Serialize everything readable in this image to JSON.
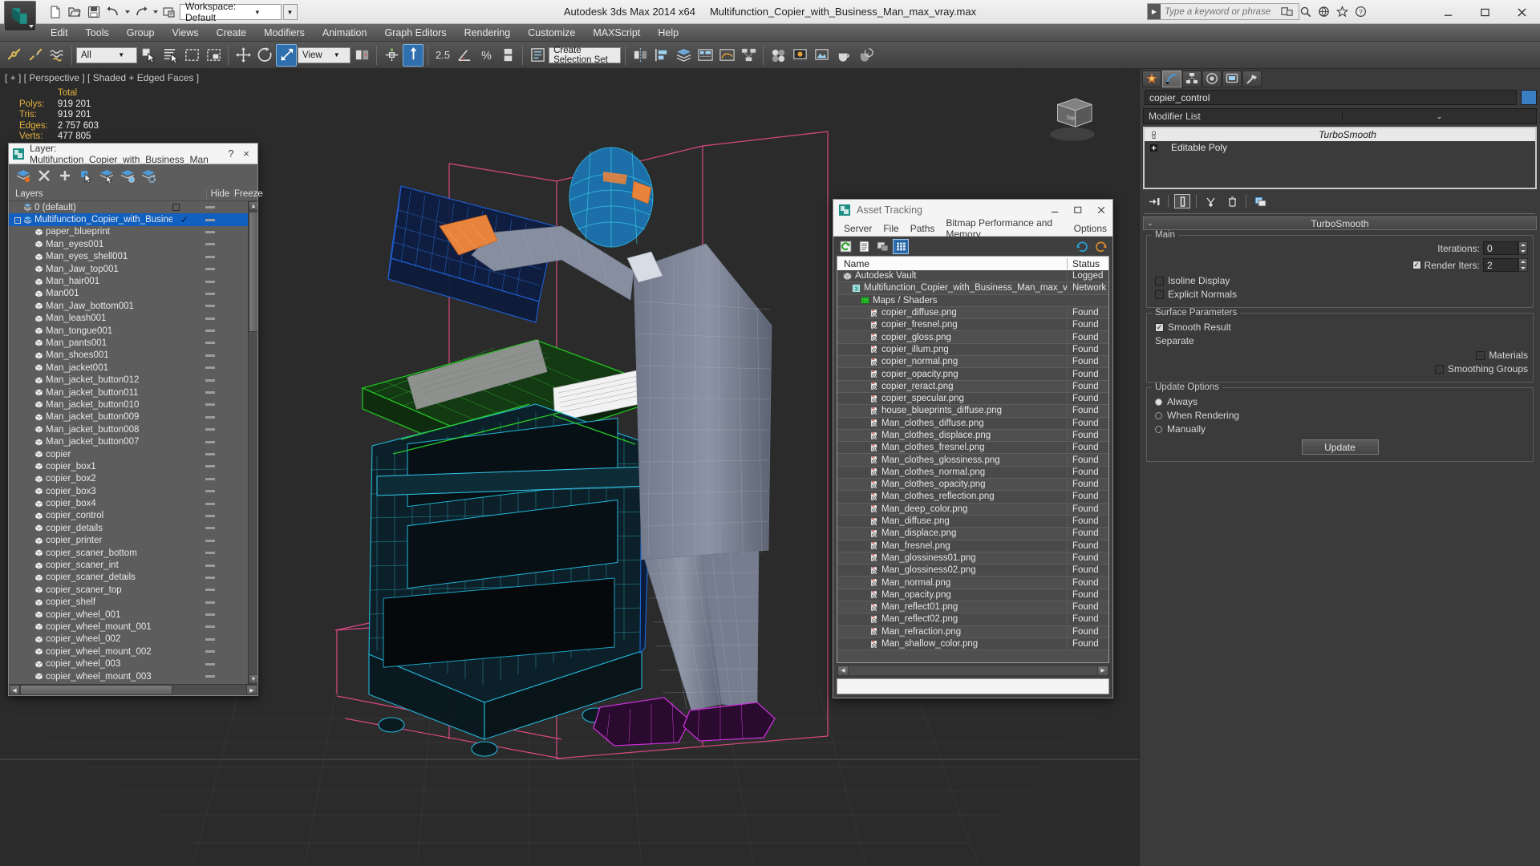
{
  "titlebar": {
    "app_title": "Autodesk 3ds Max  2014 x64",
    "file_title": "Multifunction_Copier_with_Business_Man_max_vray.max",
    "workspace_label": "Workspace: Default",
    "search_placeholder": "Type a keyword or phrase"
  },
  "menubar": {
    "items": [
      "Edit",
      "Tools",
      "Group",
      "Views",
      "Create",
      "Modifiers",
      "Animation",
      "Graph Editors",
      "Rendering",
      "Customize",
      "MAXScript",
      "Help"
    ]
  },
  "toolbar": {
    "selection_filter": "All",
    "reference_coord": "View",
    "angle_snap_value": "2.5",
    "named_selection_sets": "Create Selection Set"
  },
  "viewport": {
    "label": "[ + ] [ Perspective ] [ Shaded + Edged Faces ]",
    "stats": {
      "total_header": "Total",
      "rows": [
        {
          "label": "Polys:",
          "value": "919 201"
        },
        {
          "label": "Tris:",
          "value": "919 201"
        },
        {
          "label": "Edges:",
          "value": "2 757 603"
        },
        {
          "label": "Verts:",
          "value": "477 805"
        }
      ]
    }
  },
  "layer_dialog": {
    "title": "Layer: Multifunction_Copier_with_Business_Man",
    "help_label": "?",
    "close_label": "×",
    "columns": {
      "layers": "Layers",
      "hide": "Hide",
      "freeze": "Freeze"
    },
    "rows": [
      {
        "name": "0 (default)",
        "indent": 0,
        "type": "layer",
        "selected": false,
        "expander": "",
        "check": "box"
      },
      {
        "name": "Multifunction_Copier_with_Business_Man",
        "indent": 0,
        "type": "layer",
        "selected": true,
        "expander": "-",
        "check": "tick"
      },
      {
        "name": "paper_blueprint",
        "indent": 1,
        "type": "object",
        "selected": false,
        "expander": "",
        "check": ""
      },
      {
        "name": "Man_eyes001",
        "indent": 1,
        "type": "object",
        "selected": false,
        "expander": "",
        "check": ""
      },
      {
        "name": "Man_eyes_shell001",
        "indent": 1,
        "type": "object",
        "selected": false,
        "expander": "",
        "check": ""
      },
      {
        "name": "Man_Jaw_top001",
        "indent": 1,
        "type": "object",
        "selected": false,
        "expander": "",
        "check": ""
      },
      {
        "name": "Man_hair001",
        "indent": 1,
        "type": "object",
        "selected": false,
        "expander": "",
        "check": ""
      },
      {
        "name": "Man001",
        "indent": 1,
        "type": "object",
        "selected": false,
        "expander": "",
        "check": ""
      },
      {
        "name": "Man_Jaw_bottom001",
        "indent": 1,
        "type": "object",
        "selected": false,
        "expander": "",
        "check": ""
      },
      {
        "name": "Man_leash001",
        "indent": 1,
        "type": "object",
        "selected": false,
        "expander": "",
        "check": ""
      },
      {
        "name": "Man_tongue001",
        "indent": 1,
        "type": "object",
        "selected": false,
        "expander": "",
        "check": ""
      },
      {
        "name": "Man_pants001",
        "indent": 1,
        "type": "object",
        "selected": false,
        "expander": "",
        "check": ""
      },
      {
        "name": "Man_shoes001",
        "indent": 1,
        "type": "object",
        "selected": false,
        "expander": "",
        "check": ""
      },
      {
        "name": "Man_jacket001",
        "indent": 1,
        "type": "object",
        "selected": false,
        "expander": "",
        "check": ""
      },
      {
        "name": "Man_jacket_button012",
        "indent": 1,
        "type": "object",
        "selected": false,
        "expander": "",
        "check": ""
      },
      {
        "name": "Man_jacket_button011",
        "indent": 1,
        "type": "object",
        "selected": false,
        "expander": "",
        "check": ""
      },
      {
        "name": "Man_jacket_button010",
        "indent": 1,
        "type": "object",
        "selected": false,
        "expander": "",
        "check": ""
      },
      {
        "name": "Man_jacket_button009",
        "indent": 1,
        "type": "object",
        "selected": false,
        "expander": "",
        "check": ""
      },
      {
        "name": "Man_jacket_button008",
        "indent": 1,
        "type": "object",
        "selected": false,
        "expander": "",
        "check": ""
      },
      {
        "name": "Man_jacket_button007",
        "indent": 1,
        "type": "object",
        "selected": false,
        "expander": "",
        "check": ""
      },
      {
        "name": "copier",
        "indent": 1,
        "type": "object",
        "selected": false,
        "expander": "",
        "check": ""
      },
      {
        "name": "copier_box1",
        "indent": 1,
        "type": "object",
        "selected": false,
        "expander": "",
        "check": ""
      },
      {
        "name": "copier_box2",
        "indent": 1,
        "type": "object",
        "selected": false,
        "expander": "",
        "check": ""
      },
      {
        "name": "copier_box3",
        "indent": 1,
        "type": "object",
        "selected": false,
        "expander": "",
        "check": ""
      },
      {
        "name": "copier_box4",
        "indent": 1,
        "type": "object",
        "selected": false,
        "expander": "",
        "check": ""
      },
      {
        "name": "copier_control",
        "indent": 1,
        "type": "object",
        "selected": false,
        "expander": "",
        "check": ""
      },
      {
        "name": "copier_details",
        "indent": 1,
        "type": "object",
        "selected": false,
        "expander": "",
        "check": ""
      },
      {
        "name": "copier_printer",
        "indent": 1,
        "type": "object",
        "selected": false,
        "expander": "",
        "check": ""
      },
      {
        "name": "copier_scaner_bottom",
        "indent": 1,
        "type": "object",
        "selected": false,
        "expander": "",
        "check": ""
      },
      {
        "name": "copier_scaner_int",
        "indent": 1,
        "type": "object",
        "selected": false,
        "expander": "",
        "check": ""
      },
      {
        "name": "copier_scaner_details",
        "indent": 1,
        "type": "object",
        "selected": false,
        "expander": "",
        "check": ""
      },
      {
        "name": "copier_scaner_top",
        "indent": 1,
        "type": "object",
        "selected": false,
        "expander": "",
        "check": ""
      },
      {
        "name": "copier_shelf",
        "indent": 1,
        "type": "object",
        "selected": false,
        "expander": "",
        "check": ""
      },
      {
        "name": "copier_wheel_001",
        "indent": 1,
        "type": "object",
        "selected": false,
        "expander": "",
        "check": ""
      },
      {
        "name": "copier_wheel_mount_001",
        "indent": 1,
        "type": "object",
        "selected": false,
        "expander": "",
        "check": ""
      },
      {
        "name": "copier_wheel_002",
        "indent": 1,
        "type": "object",
        "selected": false,
        "expander": "",
        "check": ""
      },
      {
        "name": "copier_wheel_mount_002",
        "indent": 1,
        "type": "object",
        "selected": false,
        "expander": "",
        "check": ""
      },
      {
        "name": "copier_wheel_003",
        "indent": 1,
        "type": "object",
        "selected": false,
        "expander": "",
        "check": ""
      },
      {
        "name": "copier_wheel_mount_003",
        "indent": 1,
        "type": "object",
        "selected": false,
        "expander": "",
        "check": ""
      }
    ]
  },
  "asset_dialog": {
    "title": "Asset Tracking",
    "menu": [
      "Server",
      "File",
      "Paths",
      "Bitmap Performance and Memory",
      "Options"
    ],
    "columns": {
      "name": "Name",
      "status": "Status"
    },
    "rows": [
      {
        "name": "Autodesk Vault",
        "status": "Logged",
        "indent": 0,
        "icon": "vault-icon"
      },
      {
        "name": "Multifunction_Copier_with_Business_Man_max_vray.max",
        "status": "Network",
        "indent": 1,
        "icon": "max-file-icon"
      },
      {
        "name": "Maps / Shaders",
        "status": "",
        "indent": 2,
        "icon": "maps-icon"
      },
      {
        "name": "copier_diffuse.png",
        "status": "Found",
        "indent": 3,
        "icon": "bitmap-icon"
      },
      {
        "name": "copier_fresnel.png",
        "status": "Found",
        "indent": 3,
        "icon": "bitmap-icon"
      },
      {
        "name": "copier_gloss.png",
        "status": "Found",
        "indent": 3,
        "icon": "bitmap-icon"
      },
      {
        "name": "copier_illum.png",
        "status": "Found",
        "indent": 3,
        "icon": "bitmap-icon"
      },
      {
        "name": "copier_normal.png",
        "status": "Found",
        "indent": 3,
        "icon": "bitmap-icon"
      },
      {
        "name": "copier_opacity.png",
        "status": "Found",
        "indent": 3,
        "icon": "bitmap-icon"
      },
      {
        "name": "copier_reract.png",
        "status": "Found",
        "indent": 3,
        "icon": "bitmap-icon"
      },
      {
        "name": "copier_specular.png",
        "status": "Found",
        "indent": 3,
        "icon": "bitmap-icon"
      },
      {
        "name": "house_blueprints_diffuse.png",
        "status": "Found",
        "indent": 3,
        "icon": "bitmap-icon"
      },
      {
        "name": "Man_clothes_diffuse.png",
        "status": "Found",
        "indent": 3,
        "icon": "bitmap-icon"
      },
      {
        "name": "Man_clothes_displace.png",
        "status": "Found",
        "indent": 3,
        "icon": "bitmap-icon"
      },
      {
        "name": "Man_clothes_fresnel.png",
        "status": "Found",
        "indent": 3,
        "icon": "bitmap-icon"
      },
      {
        "name": "Man_clothes_glossiness.png",
        "status": "Found",
        "indent": 3,
        "icon": "bitmap-icon"
      },
      {
        "name": "Man_clothes_normal.png",
        "status": "Found",
        "indent": 3,
        "icon": "bitmap-icon"
      },
      {
        "name": "Man_clothes_opacity.png",
        "status": "Found",
        "indent": 3,
        "icon": "bitmap-icon"
      },
      {
        "name": "Man_clothes_reflection.png",
        "status": "Found",
        "indent": 3,
        "icon": "bitmap-icon"
      },
      {
        "name": "Man_deep_color.png",
        "status": "Found",
        "indent": 3,
        "icon": "bitmap-icon"
      },
      {
        "name": "Man_diffuse.png",
        "status": "Found",
        "indent": 3,
        "icon": "bitmap-icon"
      },
      {
        "name": "Man_displace.png",
        "status": "Found",
        "indent": 3,
        "icon": "bitmap-icon"
      },
      {
        "name": "Man_fresnel.png",
        "status": "Found",
        "indent": 3,
        "icon": "bitmap-icon"
      },
      {
        "name": "Man_glossiness01.png",
        "status": "Found",
        "indent": 3,
        "icon": "bitmap-icon"
      },
      {
        "name": "Man_glossiness02.png",
        "status": "Found",
        "indent": 3,
        "icon": "bitmap-icon"
      },
      {
        "name": "Man_normal.png",
        "status": "Found",
        "indent": 3,
        "icon": "bitmap-icon"
      },
      {
        "name": "Man_opacity.png",
        "status": "Found",
        "indent": 3,
        "icon": "bitmap-icon"
      },
      {
        "name": "Man_reflect01.png",
        "status": "Found",
        "indent": 3,
        "icon": "bitmap-icon"
      },
      {
        "name": "Man_reflect02.png",
        "status": "Found",
        "indent": 3,
        "icon": "bitmap-icon"
      },
      {
        "name": "Man_refraction.png",
        "status": "Found",
        "indent": 3,
        "icon": "bitmap-icon"
      },
      {
        "name": "Man_shallow_color.png",
        "status": "Found",
        "indent": 3,
        "icon": "bitmap-icon"
      }
    ]
  },
  "command_panel": {
    "object_name": "copier_control",
    "object_color": "#3a7fc1",
    "modifier_list_label": "Modifier List",
    "stack": [
      {
        "name": "TurboSmooth",
        "selected": true,
        "expander": ""
      },
      {
        "name": "Editable Poly",
        "selected": false,
        "expander": "+"
      }
    ],
    "rollup": {
      "title": "TurboSmooth",
      "minus": "-",
      "main_group": "Main",
      "iterations_label": "Iterations:",
      "iterations_value": "0",
      "render_iters_label": "Render Iters:",
      "render_iters_value": "2",
      "render_iters_checked": true,
      "isoline_display_label": "Isoline Display",
      "isoline_display_checked": false,
      "explicit_normals_label": "Explicit Normals",
      "explicit_normals_checked": false,
      "surface_params_group": "Surface Parameters",
      "smooth_result_label": "Smooth Result",
      "smooth_result_checked": true,
      "separate_label": "Separate",
      "materials_label": "Materials",
      "materials_checked": false,
      "smoothing_groups_label": "Smoothing Groups",
      "smoothing_groups_checked": false,
      "update_options_group": "Update Options",
      "update_always": "Always",
      "update_when_rendering": "When Rendering",
      "update_manually": "Manually",
      "update_selected": "Always",
      "update_button": "Update"
    }
  }
}
